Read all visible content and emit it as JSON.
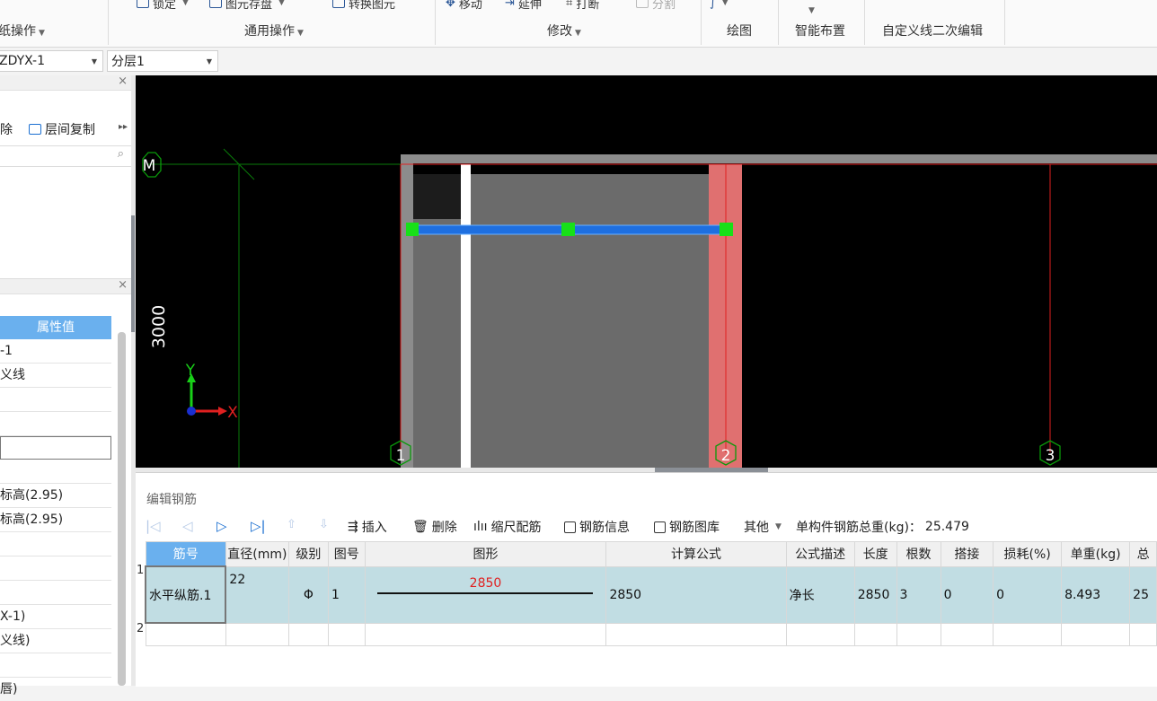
{
  "ribbon": {
    "tools_top": [
      {
        "label": "锁定",
        "icon": "lock-icon",
        "dropdown": true,
        "dim": false
      },
      {
        "label": "图元存盘",
        "icon": "save-element-icon",
        "dropdown": true,
        "dim": false
      },
      {
        "label": "转换图元",
        "icon": "convert-element-icon",
        "dropdown": false,
        "dim": false
      },
      {
        "label": "移动",
        "icon": "move-icon",
        "dropdown": false,
        "dim": false
      },
      {
        "label": "延伸",
        "icon": "extend-icon",
        "dropdown": false,
        "dim": false
      },
      {
        "label": "打断",
        "icon": "break-icon",
        "dropdown": false,
        "dim": false
      },
      {
        "label": "分割",
        "icon": "split-icon",
        "dropdown": false,
        "dim": true
      }
    ],
    "groups": [
      {
        "label": "纸操作",
        "dropdown": true
      },
      {
        "label": "通用操作",
        "dropdown": true
      },
      {
        "label": "修改",
        "dropdown": true
      },
      {
        "label": "绘图",
        "dropdown": false
      },
      {
        "label": "智能布置",
        "dropdown": false
      },
      {
        "label": "自定义线二次编辑",
        "dropdown": false
      }
    ]
  },
  "selectors": {
    "component": "ZDYX-1",
    "layer": "分层1"
  },
  "left_panel": {
    "toolbar": [
      {
        "label": "除",
        "icon": ""
      },
      {
        "label": "层间复制",
        "icon": "copy-icon"
      }
    ],
    "props_header": "属性值",
    "props_rows": [
      "-1",
      "义线",
      "",
      "",
      "",
      "标高(2.95)",
      "标高(2.95)",
      "",
      "",
      "",
      "X-1)",
      "义线)",
      "",
      "唇)"
    ]
  },
  "canvas": {
    "axes": [
      {
        "label": "M",
        "kind": "row"
      },
      {
        "label": "1",
        "kind": "col"
      },
      {
        "label": "2",
        "kind": "col"
      },
      {
        "label": "3",
        "kind": "col"
      }
    ],
    "dimension": "3000",
    "ucs": {
      "x": "X",
      "y": "Y"
    }
  },
  "editor": {
    "title": "编辑钢筋",
    "toolbar": [
      {
        "label": "插入",
        "icon": "insert-row-icon"
      },
      {
        "label": "删除",
        "icon": "delete-icon"
      },
      {
        "label": "缩尺配筋",
        "icon": "scale-rebar-icon"
      },
      {
        "label": "钢筋信息",
        "icon": "rebar-info-icon"
      },
      {
        "label": "钢筋图库",
        "icon": "rebar-library-icon"
      },
      {
        "label": "其他",
        "icon": ""
      }
    ],
    "total_weight_label": "单构件钢筋总重(kg)：",
    "total_weight": "25.479",
    "columns": [
      "筋号",
      "直径(mm)",
      "级别",
      "图号",
      "图形",
      "计算公式",
      "公式描述",
      "长度",
      "根数",
      "搭接",
      "损耗(%)",
      "单重(kg)",
      "总"
    ],
    "rows": [
      {
        "num": "1",
        "cells": [
          "水平纵筋.1",
          "22",
          "Φ",
          "1",
          "2850",
          "2850",
          "净长",
          "2850",
          "3",
          "0",
          "0",
          "8.493",
          "25"
        ]
      },
      {
        "num": "2",
        "cells": [
          "",
          "",
          "",
          "",
          "",
          "",
          "",
          "",
          "",
          "",
          "",
          "",
          ""
        ]
      }
    ]
  }
}
